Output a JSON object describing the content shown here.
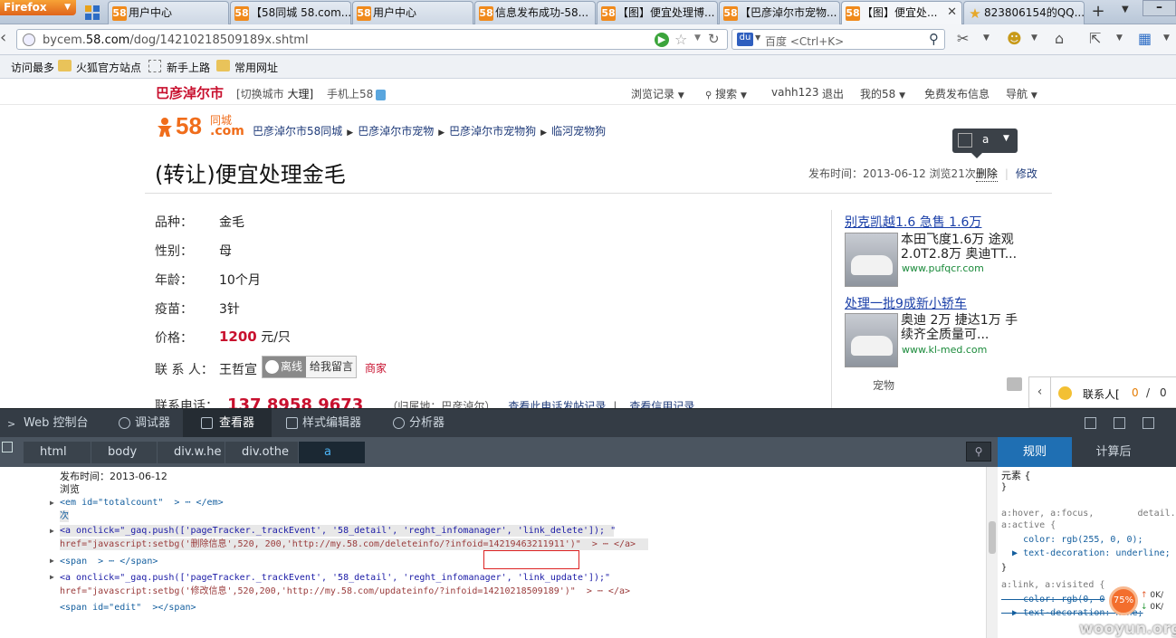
{
  "browser": {
    "menu_label": "Firefox",
    "tabs": [
      {
        "icon": "58",
        "title": "用户中心"
      },
      {
        "icon": "58",
        "title": "【58同城 58.com..."
      },
      {
        "icon": "58",
        "title": "用户中心"
      },
      {
        "icon": "58",
        "title": "信息发布成功-58..."
      },
      {
        "icon": "58",
        "title": "【图】便宜处理博..."
      },
      {
        "icon": "58",
        "title": "【巴彦淖尔市宠物..."
      },
      {
        "icon": "58",
        "title": "【图】便宜处..."
      },
      {
        "icon": "star",
        "title": "823806154的QQ..."
      }
    ],
    "url_prefix": "bycem.",
    "url_domain": "58.com",
    "url_path": "/dog/14210218509189x.shtml",
    "search_placeholder": "百度 <Ctrl+K>",
    "bookmarks": [
      "访问最多",
      "火狐官方站点",
      "新手上路",
      "常用网址"
    ]
  },
  "site": {
    "city": "巴彦淖尔市",
    "switch_label": "[切换城市",
    "switch_city": "大理]",
    "mobile": "手机上58",
    "top_links": [
      "浏览记录",
      "搜索",
      "vahh123",
      "退出",
      "我的58",
      "免费发布信息",
      "导航"
    ],
    "logo_num": "58",
    "logo_tc": "同城",
    "logo_com": ".com",
    "breadcrumbs": [
      "巴彦淖尔市58同城",
      "巴彦淖尔市宠物",
      "巴彦淖尔市宠物狗",
      "临河宠物狗"
    ],
    "title": "(转让)便宜处理金毛",
    "meta_date": "发布时间：2013-06-12 浏览21次",
    "delete_label": "删除",
    "edit_label": "修改",
    "fields": [
      {
        "label": "品种：",
        "value": "金毛"
      },
      {
        "label": "性别：",
        "value": "母"
      },
      {
        "label": "年龄：",
        "value": "10个月"
      },
      {
        "label": "疫苗：",
        "value": "3针"
      }
    ],
    "price_label": "价格：",
    "price_value": "1200",
    "price_unit": "元/只",
    "contact_label": "联 系 人：",
    "contact_name": "王哲宣",
    "status_offline": "离线",
    "leave_msg": "给我留言",
    "merchant": "商家",
    "phone_label": "联系电话：",
    "phone_number": "137 8958 9673",
    "phone_loc": "（归属地：巴彦淖尔）",
    "phone_link1": "查看此电话发帖记录",
    "phone_link2": "查看信用记录",
    "ads": [
      {
        "title": "别克凯越1.6 急售 1.6万",
        "text": "本田飞度1.6万 途观2.0T2.8万 奥迪TT...",
        "url": "www.pufqcr.com"
      },
      {
        "title": "处理一批9成新小轿车",
        "text": "奥迪 2万 捷达1万 手续齐全质量可...",
        "url": "www.kl-med.com"
      }
    ],
    "pet_label": "宠物",
    "inspector_label": "a",
    "contacts_label": "联系人[",
    "contacts_online": "0",
    "contacts_sep": "/",
    "contacts_total": "0"
  },
  "devtools": {
    "tabs": [
      "Web 控制台",
      "调试器",
      "查看器",
      "样式编辑器",
      "分析器"
    ],
    "crumbs": [
      "html",
      "body",
      "div.w.he",
      "div.othe",
      "a"
    ],
    "right_tabs": [
      "规则",
      "计算后"
    ],
    "markup_lines": [
      "发布时间：2013-06-12",
      "浏览",
      "<em id=\"totalcount\"  > ⋯ </em>",
      "次",
      "<a onclick=\"_gaq.push(['pageTracker._trackEvent', '58_detail', 'reght_infomanager', 'link_delete']); \"",
      "href=\"javascript:setbg('删除信息',520, 200,'http://my.58.com/deleteinfo/?infoid=14219463211911')\"  > ⋯ </a>",
      "<span  > ⋯ </span>",
      "<a onclick=\"_gaq.push(['pageTracker._trackEvent', '58_detail', 'reght_infomanager', 'link_update']);\"",
      "href=\"javascript:setbg('修改信息',520,200,'http://my.58.com/updateinfo/?infoid=14210218509189')\"  > ⋯ </a>",
      "<span id=\"edit\"  ></span>"
    ],
    "rules_lines": [
      "元素 {",
      "}",
      "a:hover, a:focus,        detail.c",
      "a:active {",
      "    color: rgb(255, 0, 0);",
      "  ▶ text-decoration: underline;",
      "}",
      "a:link, a:visited {",
      "    color: rgb(0, 0",
      "  ▶ text-decoration: none;"
    ],
    "ring_percent": "75%",
    "speed_up": "0K/",
    "speed_down": "0K/"
  },
  "watermark": "wooyun.org"
}
